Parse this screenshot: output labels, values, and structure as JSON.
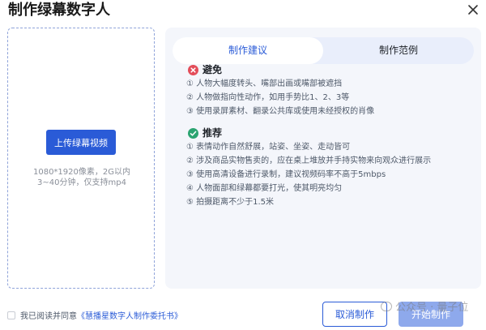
{
  "dialog": {
    "title": "制作绿幕数字人",
    "close_icon": "close-icon"
  },
  "upload": {
    "button_label": "上传绿幕视频",
    "hint_line1": "1080*1920像素，2G以内",
    "hint_line2": "3~40分钟，仅支持mp4"
  },
  "tabs": [
    {
      "label": "制作建议",
      "active": true
    },
    {
      "label": "制作范例",
      "active": false
    }
  ],
  "avoid": {
    "icon": "close-circle-icon",
    "title": "避免",
    "items": [
      "① 人物大幅度转头、嘴部出画或嘴部被遮挡",
      "② 人物做指向性动作，如用手势比1、2、3等",
      "③ 使用录屏素材、翻录公共库或使用未经授权的肖像"
    ]
  },
  "recommend": {
    "icon": "check-circle-icon",
    "title": "推荐",
    "items": [
      "① 表情动作自然舒展，站姿、坐姿、走动皆可",
      "② 涉及商品实物售卖的，应在桌上堆放并手持实物来向观众进行展示",
      "③ 使用高清设备进行录制，建议视频码率不高于5mbps",
      "④ 人物面部和绿幕都要打光，使其明亮均匀",
      "⑤ 拍摄距离不少于1.5米"
    ]
  },
  "footer": {
    "agree_text": "我已阅读并同意",
    "agree_link": "《慧播星数字人制作委托书》",
    "cancel_label": "取消制作",
    "start_label": "开始制作",
    "watermark": "公众号 · 量子位"
  },
  "colors": {
    "accent": "#2a5bd7",
    "avoid": "#e34d59",
    "recommend": "#2ba471",
    "panel_bg": "#f4f6fb"
  }
}
